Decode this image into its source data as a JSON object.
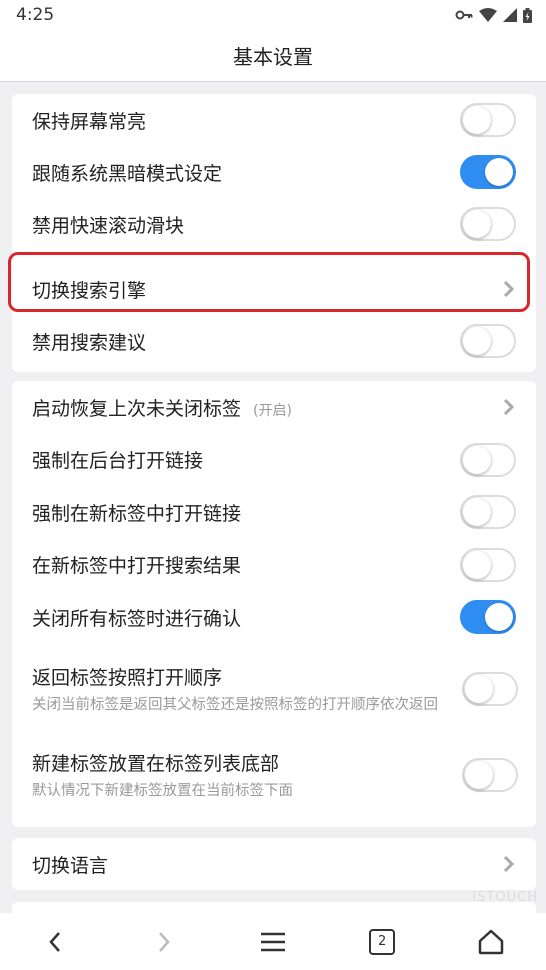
{
  "status": {
    "time": "4:25"
  },
  "header": {
    "title": "基本设置"
  },
  "section1": [
    {
      "label": "保持屏幕常亮",
      "toggle": false
    },
    {
      "label": "跟随系统黑暗模式设定",
      "toggle": true
    },
    {
      "label": "禁用快速滚动滑块",
      "toggle": false
    },
    {
      "label": "切换搜索引擎",
      "type": "link"
    },
    {
      "label": "禁用搜索建议",
      "toggle": false
    }
  ],
  "section2": [
    {
      "label": "启动恢复上次未关闭标签",
      "hint": "(开启)",
      "type": "link"
    },
    {
      "label": "强制在后台打开链接",
      "toggle": false
    },
    {
      "label": "强制在新标签中打开链接",
      "toggle": false
    },
    {
      "label": "在新标签中打开搜索结果",
      "toggle": false
    },
    {
      "label": "关闭所有标签时进行确认",
      "toggle": true
    },
    {
      "label": "返回标签按照打开顺序",
      "desc": "关闭当前标签是返回其父标签还是按照标签的打开顺序依次返回",
      "toggle": false
    },
    {
      "label": "新建标签放置在标签列表底部",
      "desc": "默认情况下新建标签放置在当前标签下面",
      "toggle": false
    }
  ],
  "section3": [
    {
      "label": "切换语言",
      "type": "link"
    }
  ],
  "navbar": {
    "tab_count": "2"
  },
  "watermark": "ISTOUCH",
  "colors": {
    "accent": "#2f8cf0",
    "highlight": "#d9272e",
    "background": "#f0f0f2"
  }
}
